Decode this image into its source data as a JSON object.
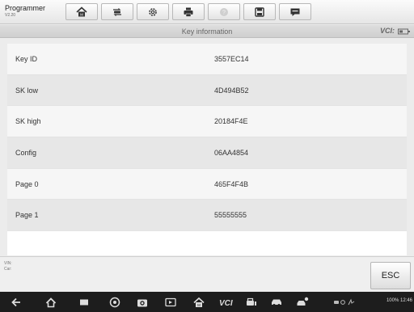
{
  "app": {
    "title": "Programmer",
    "version": "V2.20"
  },
  "toolbar": {
    "buttons": [
      "home-icon",
      "vehicle-swap-icon",
      "settings-icon",
      "print-icon",
      "help-icon",
      "save-icon",
      "data-icon"
    ]
  },
  "titlebar": {
    "title": "Key information",
    "vci": "VCI:"
  },
  "table": {
    "rows": [
      {
        "key": "Key ID",
        "value": "3557EC14"
      },
      {
        "key": "SK low",
        "value": "4D494B52"
      },
      {
        "key": "SK high",
        "value": "20184F4E"
      },
      {
        "key": "Config",
        "value": "06AA4854"
      },
      {
        "key": "Page 0",
        "value": "465F4F4B"
      },
      {
        "key": "Page 1",
        "value": "55555555"
      }
    ]
  },
  "info": {
    "vin_label": "VIN:",
    "car_label": "Car:"
  },
  "esc_label": "ESC",
  "statusbar": {
    "time": "100% 12:46"
  },
  "colors": {
    "toolbar_bg": "#eeeeee",
    "nav_bg": "#1d1d1d",
    "row_odd": "#f6f6f6",
    "row_even": "#e7e7e7"
  }
}
